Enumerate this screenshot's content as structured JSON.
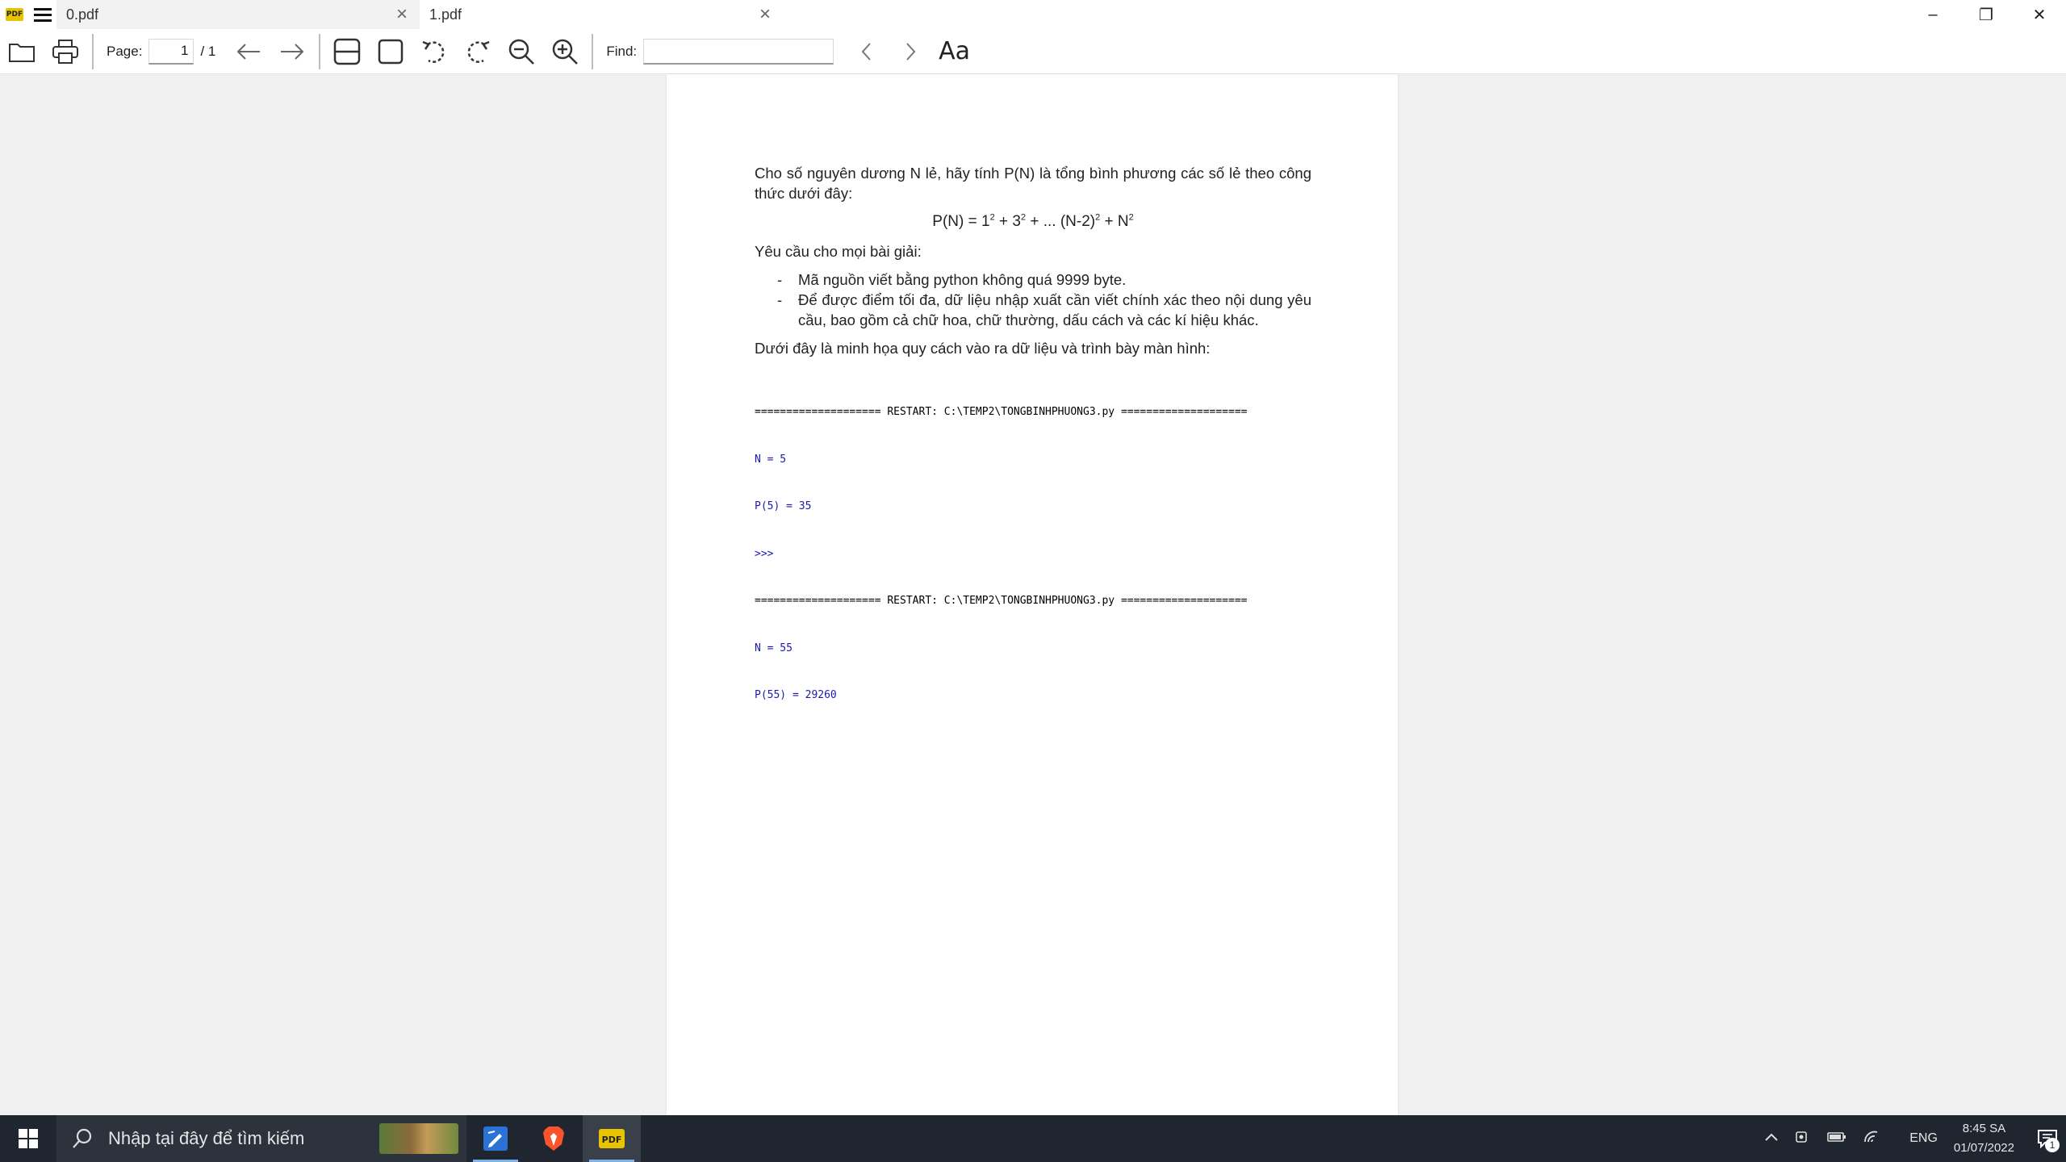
{
  "window": {
    "tabs": [
      {
        "label": "0.pdf",
        "active": true
      },
      {
        "label": "1.pdf",
        "active": false
      }
    ],
    "close_glyph": "×",
    "controls": {
      "minimize": "–",
      "restore": "❐",
      "close": "✕"
    }
  },
  "toolbar": {
    "page_label": "Page:",
    "page_current": "1",
    "page_total": "/ 1",
    "find_label": "Find:",
    "find_value": "",
    "font_toggle_label": "Aa"
  },
  "document": {
    "intro": "Cho số nguyên dương N lẻ, hãy tính P(N) là tổng bình phương các số lẻ theo công thức dưới đây:",
    "formula": {
      "lhs": "P(N) = 1",
      "t2": " + 3",
      "t3": " + ... (N-2)",
      "t4": " + N",
      "exp": "2"
    },
    "requirements_heading": "Yêu cầu cho mọi bài giải:",
    "requirements": [
      "Mã nguồn viết bằng python không quá 9999 byte.",
      "Để được điểm tối đa, dữ liệu nhập xuất cần viết chính xác theo nội dung yêu cầu, bao gồm cả chữ hoa, chữ thường, dấu cách và các kí hiệu khác."
    ],
    "demo_heading": "Dưới đây là minh họa quy cách vào ra dữ liệu và trình bày màn hình:",
    "console": [
      {
        "text": "==================== RESTART: C:\\TEMP2\\TONGBINHPHUONG3.py ====================",
        "kind": "out"
      },
      {
        "text": "N = 5",
        "kind": "in"
      },
      {
        "text": "P(5) = 35",
        "kind": "in"
      },
      {
        "text": ">>>",
        "kind": "in"
      },
      {
        "text": "==================== RESTART: C:\\TEMP2\\TONGBINHPHUONG3.py ====================",
        "kind": "out"
      },
      {
        "text": "N = 55",
        "kind": "in"
      },
      {
        "text": "P(55) = 29260",
        "kind": "in"
      }
    ]
  },
  "taskbar": {
    "search_placeholder": "Nhập tại đây để tìm kiếm",
    "apps": [
      {
        "name": "whiteboard-app",
        "active": false
      },
      {
        "name": "brave-browser",
        "active": false
      },
      {
        "name": "pdf-reader",
        "active": true
      }
    ],
    "language": "ENG",
    "time": "8:45 SA",
    "date": "01/07/2022",
    "notification_count": "1"
  },
  "colors": {
    "console_input": "#1a1ab0",
    "taskbar_bg": "#1f2630",
    "pdf_icon": "#e8c300",
    "brave": "#fb542b",
    "whiteboard": "#2b72d7"
  }
}
